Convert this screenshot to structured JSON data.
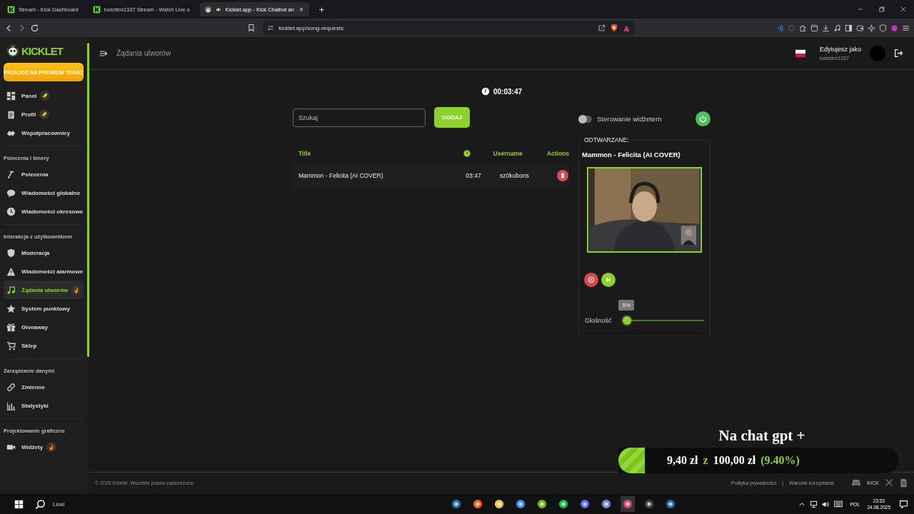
{
  "browser": {
    "tabs": [
      {
        "title": "Stream - Kick Dashboard",
        "selected": false,
        "kind": "kick"
      },
      {
        "title": "toxictimi1337 Stream - Watch Live o",
        "selected": false,
        "kind": "kick"
      },
      {
        "title": "Kicklet.app - Kick Chatbot an",
        "selected": true,
        "kind": "kicklet",
        "close": "×"
      }
    ],
    "new_tab": "+",
    "address": "kicklet.app/song-requests"
  },
  "app": {
    "logo": "KICKLET",
    "premium_button": "PRZEJDŹ NA PREMIUM TERAZ",
    "sidebar": [
      {
        "items": [
          {
            "label": "Panel",
            "selected": false,
            "kind": "rocket_badge"
          },
          {
            "label": "Profil",
            "selected": false,
            "kind": "rocket_badge"
          },
          {
            "label": "Współpracownicy",
            "selected": false
          }
        ]
      },
      {
        "heading": "Polecenia i timery",
        "items": [
          {
            "label": "Polecenia",
            "selected": false
          },
          {
            "label": "Wiadomości globalne",
            "selected": false
          },
          {
            "label": "Wiadomości okresowe",
            "selected": false
          }
        ]
      },
      {
        "heading": "Interakcja z użytkownikiem",
        "items": [
          {
            "label": "Moderacja",
            "selected": false
          },
          {
            "label": "Wiadomości alarmowe",
            "selected": false
          },
          {
            "label": "Żądania utworów",
            "selected": true,
            "kind": "flame_badge"
          },
          {
            "label": "System punktowy",
            "selected": false
          },
          {
            "label": "Giveaway",
            "selected": false
          },
          {
            "label": "Sklep",
            "selected": false
          }
        ]
      },
      {
        "heading": "Zarządzanie danymi",
        "items": [
          {
            "label": "Zmienne",
            "selected": false
          },
          {
            "label": "Statystyki",
            "selected": false
          }
        ]
      },
      {
        "heading": "Projektowanie graficzne",
        "items": [
          {
            "label": "Widżety",
            "selected": false,
            "kind": "flame_badge"
          }
        ]
      }
    ],
    "header": {
      "page_title": "Żądania utworów",
      "editing_label": "Edytujesz jako",
      "username": "toxictimi1337"
    },
    "timer": "00:03:47",
    "search": {
      "placeholder": "Szukaj"
    },
    "add_button": "DODAJ",
    "widget_control": {
      "label": "Sterowanie widżetem",
      "on": false
    },
    "table": {
      "columns": [
        {
          "label": "Title"
        },
        {
          "kind": "clock"
        },
        {
          "label": "Username"
        },
        {
          "label": "Actions"
        }
      ],
      "rows": [
        {
          "title": "Mammon - Felicita (AI COVER)",
          "duration": "03:47",
          "username": "sz0kobons"
        }
      ]
    },
    "now_playing": {
      "legend": "ODTWARZANE:",
      "title": "Mammon - Felicita (AI COVER)",
      "volume": {
        "label": "Głośność",
        "level": 0.05,
        "tooltip": "5%"
      }
    },
    "footer": {
      "copyright": "© 2025 Kicklet. Wszelkie prawa zastrzeżone.",
      "links": [
        "Polityka prywatności",
        "Warunki korzystania"
      ],
      "separator": "|",
      "kick_logo": "KICK"
    }
  },
  "donation_overlay": {
    "title": "Na chat gpt +",
    "raised": "9,40 zł",
    "of": "z",
    "goal": "100,00 zł",
    "percent": "(9.40%)",
    "level": 0.094
  },
  "taskbar": {
    "search_label": "Linki",
    "language": "POL",
    "time": "23:53",
    "date": "24.08.2025"
  }
}
